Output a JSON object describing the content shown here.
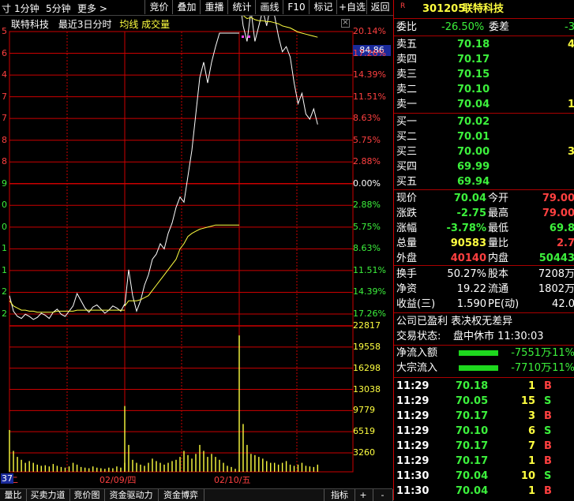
{
  "toolbar": {
    "left_items": [
      "1分钟",
      "5分钟",
      "更多 >"
    ],
    "buttons": [
      "竞价",
      "叠加",
      "重播",
      "统计",
      "画线",
      "F10",
      "标记",
      "+自选",
      "返回"
    ]
  },
  "chart_header": {
    "stock_name": "联特科技",
    "period": "最近3日分时",
    "avg_label": "均线",
    "vol_label": "成交量",
    "cursor_price": "84.86"
  },
  "chart_data": {
    "type": "line",
    "price_axis_right": [
      "20.14%",
      "17.26%",
      "14.39%",
      "11.51%",
      "8.63%",
      "5.75%",
      "2.88%",
      "0.00%",
      "2.88%",
      "5.75%",
      "8.63%",
      "11.51%",
      "14.39%",
      "17.26%"
    ],
    "price_axis_left": [
      "5",
      "6",
      "4",
      "7",
      "7",
      "8",
      "8",
      "9",
      "0",
      "0",
      "1",
      "1",
      "2",
      "2"
    ],
    "volume_axis_right": [
      "22817",
      "19558",
      "16298",
      "13038",
      "9779",
      "6519",
      "3260"
    ],
    "date_labels": [
      "二",
      "02/09/四",
      "02/10/五"
    ],
    "volume_scale_label": "37",
    "days": 3,
    "price_series": [
      {
        "day": 0,
        "values": [
          62.0,
          60.5,
          60.0,
          59.8,
          60.2,
          60.0,
          59.7,
          59.9,
          60.3,
          60.1,
          59.8,
          60.4,
          60.7,
          60.2,
          60.0,
          60.5,
          61.0,
          62.2,
          61.5,
          60.8,
          60.4,
          60.9,
          61.1,
          60.7,
          60.3,
          60.6,
          61.0,
          60.8,
          60.5,
          61.2
        ]
      },
      {
        "day": 1,
        "values": [
          61.0,
          64.5,
          62.0,
          60.5,
          61.5,
          63.0,
          64.0,
          65.5,
          66.0,
          67.0,
          66.5,
          68.0,
          69.0,
          70.5,
          71.5,
          71.0,
          73.5,
          76.0,
          79.5,
          83.0,
          84.5,
          82.5,
          84.5,
          86.0,
          87.3,
          87.3,
          87.3,
          87.3,
          87.3,
          87.3
        ]
      },
      {
        "day": 2,
        "values": [
          91.0,
          88.0,
          86.5,
          89.5,
          86.5,
          88.0,
          89.5,
          88.0,
          90.0,
          89.0,
          87.0,
          85.5,
          86.0,
          85.0,
          82.5,
          80.5,
          81.5,
          79.5,
          79.0,
          80.0,
          78.5
        ]
      }
    ],
    "avg_series": [
      {
        "day": 0,
        "values": [
          61.5,
          61.0,
          60.8,
          60.6,
          60.6,
          60.5,
          60.5,
          60.4,
          60.4,
          60.4,
          60.4,
          60.4,
          60.5,
          60.5,
          60.5,
          60.5,
          60.5,
          60.6,
          60.6,
          60.6,
          60.6,
          60.6,
          60.6,
          60.6,
          60.6,
          60.6,
          60.6,
          60.6,
          60.6,
          60.6
        ]
      },
      {
        "day": 1,
        "values": [
          61.0,
          61.5,
          61.5,
          61.5,
          61.6,
          61.8,
          62.0,
          62.5,
          63.0,
          63.5,
          64.0,
          64.5,
          65.0,
          65.5,
          66.5,
          67.0,
          67.7,
          68.0,
          68.2,
          68.4,
          68.5,
          68.6,
          68.7,
          68.8,
          68.8,
          68.8,
          68.8,
          68.8,
          68.8,
          68.8
        ]
      },
      {
        "day": 2,
        "values": [
          89.5,
          89.0,
          88.7,
          88.8,
          88.6,
          88.5,
          88.5,
          88.4,
          88.4,
          88.3,
          88.2,
          88.0,
          87.9,
          87.8,
          87.6,
          87.4,
          87.3,
          87.2,
          87.1,
          87.0,
          86.9
        ]
      }
    ],
    "volume_series": [
      {
        "day": 0,
        "values": [
          7000,
          3500,
          2500,
          2000,
          1500,
          1800,
          1500,
          1200,
          1000,
          1100,
          900,
          1300,
          1000,
          800,
          700,
          900,
          1500,
          1200,
          800,
          700,
          600,
          900,
          700,
          600,
          500,
          700,
          600,
          900,
          700,
          1500
        ]
      },
      {
        "day": 1,
        "values": [
          11000,
          4500,
          2000,
          1500,
          1200,
          1000,
          1500,
          2200,
          1800,
          1500,
          1200,
          1500,
          1800,
          2000,
          2500,
          3500,
          2800,
          2200,
          3000,
          4500,
          3500,
          2500,
          3000,
          2500,
          2000,
          1500,
          1000,
          800,
          500,
          300
        ]
      },
      {
        "day": 2,
        "values": [
          22817,
          8000,
          4500,
          3000,
          2800,
          2500,
          2200,
          1800,
          1500,
          1500,
          1200,
          1500,
          1800,
          1200,
          1000,
          1200,
          1500,
          1000,
          900,
          800,
          1200
        ]
      }
    ],
    "colors": {
      "price": "#ffffff",
      "avg": "#ffff40",
      "volume": "#ffff40",
      "grid": "#cc0000",
      "up": "#ff4040",
      "down": "#3cf03c"
    }
  },
  "quote": {
    "code": "301205",
    "name": "联特科技",
    "weibi_label": "委比",
    "weibi_value": "-26.50%",
    "weicha_label": "委差",
    "weicha_value": "-3",
    "sells": [
      {
        "label": "卖五",
        "price": "70.18",
        "vol": "4"
      },
      {
        "label": "卖四",
        "price": "70.17",
        "vol": ""
      },
      {
        "label": "卖三",
        "price": "70.15",
        "vol": ""
      },
      {
        "label": "卖二",
        "price": "70.10",
        "vol": ""
      },
      {
        "label": "卖一",
        "price": "70.04",
        "vol": "1"
      }
    ],
    "buys": [
      {
        "label": "买一",
        "price": "70.02",
        "vol": ""
      },
      {
        "label": "买二",
        "price": "70.01",
        "vol": ""
      },
      {
        "label": "买三",
        "price": "70.00",
        "vol": "3"
      },
      {
        "label": "买四",
        "price": "69.99",
        "vol": ""
      },
      {
        "label": "买五",
        "price": "69.94",
        "vol": ""
      }
    ],
    "stats": [
      {
        "l1": "现价",
        "v1": "70.04",
        "l2": "今开",
        "v2": "79.00"
      },
      {
        "l1": "涨跌",
        "v1": "-2.75",
        "l2": "最高",
        "v2": "79.00"
      },
      {
        "l1": "涨幅",
        "v1": "-3.78%",
        "l2": "最低",
        "v2": "69.8"
      },
      {
        "l1": "总量",
        "v1": "90583",
        "l2": "量比",
        "v2": "2.7"
      },
      {
        "l1": "外盘",
        "v1": "40140",
        "l2": "内盘",
        "v2": "50443"
      }
    ],
    "stats2": [
      {
        "l1": "换手",
        "v1": "50.27%",
        "l2": "股本",
        "v2": "7208万"
      },
      {
        "l1": "净资",
        "v1": "19.22",
        "l2": "流通",
        "v2": "1802万"
      },
      {
        "l1": "收益(三)",
        "v1": "1.590",
        "l2": "PE(动)",
        "v2": "42.0"
      }
    ],
    "notice": "公司已盈利 表决权无差异",
    "status_label": "交易状态:",
    "status_value": "盘中休市 11:30:03",
    "flows": [
      {
        "label": "净流入额",
        "value": "-7551万",
        "pct": "-11%"
      },
      {
        "label": "大宗流入",
        "value": "-7710万",
        "pct": "-11%"
      }
    ],
    "ticks": [
      {
        "time": "11:29",
        "price": "70.18",
        "vol": "1",
        "side": "B"
      },
      {
        "time": "11:29",
        "price": "70.05",
        "vol": "15",
        "side": "S"
      },
      {
        "time": "11:29",
        "price": "70.17",
        "vol": "3",
        "side": "B"
      },
      {
        "time": "11:29",
        "price": "70.10",
        "vol": "6",
        "side": "S"
      },
      {
        "time": "11:29",
        "price": "70.17",
        "vol": "7",
        "side": "B"
      },
      {
        "time": "11:29",
        "price": "70.17",
        "vol": "1",
        "side": "B"
      },
      {
        "time": "11:30",
        "price": "70.04",
        "vol": "10",
        "side": "S"
      },
      {
        "time": "11:30",
        "price": "70.04",
        "vol": "1",
        "side": "B"
      }
    ]
  },
  "bottom_tabs": [
    "量比",
    "买卖力道",
    "竞价图",
    "资金驱动力",
    "资金博弈"
  ],
  "bottom_right": [
    "指标",
    "+",
    "-"
  ]
}
